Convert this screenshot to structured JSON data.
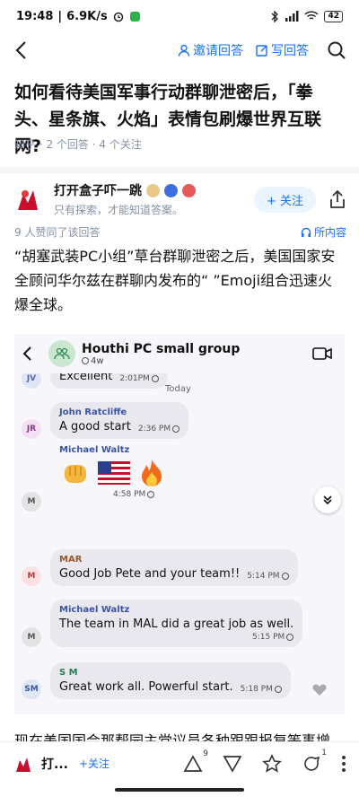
{
  "status_bar": {
    "time": "19:48",
    "speed": "6.9K/s",
    "battery": "42"
  },
  "nav": {
    "invite_label": "邀请回答",
    "write_label": "写回答"
  },
  "question": {
    "title": "如何看待美国军事行动群聊泄密后，「拳头、星条旗、火焰」表情包刷爆世界互联网?",
    "meta": "知乎 · 2 个回答 · 4 个关注"
  },
  "author": {
    "name": "打开盒子吓一跳",
    "bio": "只有探索，才能知道答案。",
    "follow_label": "+ 关注"
  },
  "voters": {
    "text": "9 人赞同了该回答",
    "inside_label": "所内容"
  },
  "answer": {
    "paragraph": "“胡塞武装PC小组”草台群聊泄密之后，美国国家安全顾问华尔兹在群聊内发布的“ ”Emoji组合迅速火爆全球。"
  },
  "chat": {
    "group_name": "Houthi PC small group",
    "group_sub": "4w",
    "today_label": "Today",
    "messages": [
      {
        "initials": "JV",
        "sender": "",
        "text": "Excellent",
        "time": "2:01PM"
      },
      {
        "initials": "JR",
        "sender": "John Ratcliffe",
        "text": "A good start",
        "time": "2:36 PM"
      },
      {
        "initials": "M",
        "sender": "Michael Waltz",
        "text": "",
        "time": "4:58 PM"
      },
      {
        "initials": "M",
        "sender": "MAR",
        "text": "Good Job Pete and your team!!",
        "time": "5:14 PM"
      },
      {
        "initials": "M",
        "sender": "Michael Waltz",
        "text": "The team in MAL did a great job  as well.",
        "time": "5:15 PM"
      },
      {
        "initials": "SM",
        "sender": "S M",
        "text": "Great work all. Powerful start.",
        "time": "5:18 PM"
      }
    ],
    "emoji": [
      "fist-icon",
      "us-flag-icon",
      "fire-icon"
    ]
  },
  "bottom_text": "现在美国国会那帮园主党议员各种跟跟报复等事增",
  "bottom_bar": {
    "name": "打...",
    "follow_label": "+关注",
    "upvote_count": "9",
    "comment_count": "1"
  },
  "colors": {
    "accent": "#1772f6",
    "bubble": "#e9e8ee",
    "chat_bg": "#f7f6fa"
  }
}
